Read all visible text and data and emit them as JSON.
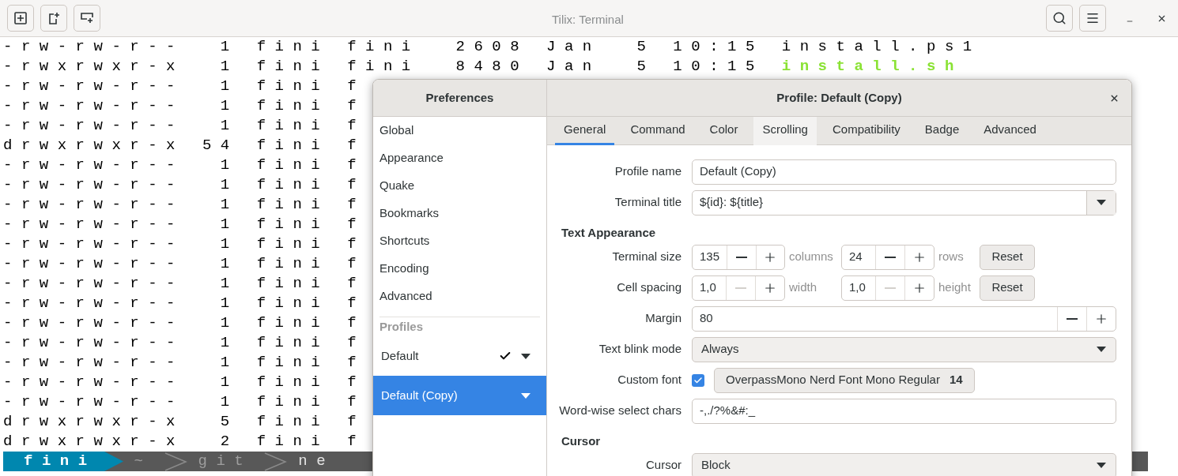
{
  "window": {
    "title": "Tilix: Terminal"
  },
  "terminal": {
    "lines": [
      {
        "text": "-rw-rw-r--  1 fini fini  2608 Jan  5 10:15 ",
        "file": "install.ps1",
        "executable": false
      },
      {
        "text": "-rwxrwxr-x  1 fini fini  8480 Jan  5 10:15 ",
        "file": "install.sh",
        "executable": true
      },
      {
        "text": "-rw-rw-r--  1 fini f"
      },
      {
        "text": "-rw-rw-r--  1 fini f"
      },
      {
        "text": "-rw-rw-r--  1 fini f"
      },
      {
        "text": "drwxrwxr-x 54 fini f"
      },
      {
        "text": "-rw-rw-r--  1 fini f"
      },
      {
        "text": "-rw-rw-r--  1 fini f"
      },
      {
        "text": "-rw-rw-r--  1 fini f"
      },
      {
        "text": "-rw-rw-r--  1 fini f"
      },
      {
        "text": "-rw-rw-r--  1 fini f"
      },
      {
        "text": "-rw-rw-r--  1 fini f"
      },
      {
        "text": "-rw-rw-r--  1 fini f"
      },
      {
        "text": "-rw-rw-r--  1 fini f"
      },
      {
        "text": "-rw-rw-r--  1 fini f"
      },
      {
        "text": "-rw-rw-r--  1 fini f"
      },
      {
        "text": "-rw-rw-r--  1 fini f"
      },
      {
        "text": "-rw-rw-r--  1 fini f"
      },
      {
        "text": "-rw-rw-r--  1 fini f"
      },
      {
        "text": "drwxrwxr-x  5 fini f"
      },
      {
        "text": "drwxrwxr-x  2 fini f"
      }
    ],
    "prompt": {
      "user": "fini",
      "segments": [
        "~",
        "git",
        "ne"
      ]
    }
  },
  "preferences": {
    "title": "Preferences",
    "items": [
      {
        "label": "Global",
        "selected": false
      },
      {
        "label": "Appearance",
        "selected": false
      },
      {
        "label": "Quake",
        "selected": false
      },
      {
        "label": "Bookmarks",
        "selected": false
      },
      {
        "label": "Shortcuts",
        "selected": false
      },
      {
        "label": "Encoding",
        "selected": false
      },
      {
        "label": "Advanced",
        "selected": false
      }
    ],
    "profiles_heading": "Profiles",
    "profiles": [
      {
        "label": "Default",
        "default": true,
        "selected": false
      },
      {
        "label": "Default (Copy)",
        "default": false,
        "selected": true
      }
    ]
  },
  "profile": {
    "title": "Profile: Default (Copy)",
    "tabs": [
      {
        "label": "General",
        "selected": true,
        "hovered": false
      },
      {
        "label": "Command",
        "selected": false,
        "hovered": false
      },
      {
        "label": "Color",
        "selected": false,
        "hovered": false
      },
      {
        "label": "Scrolling",
        "selected": false,
        "hovered": true
      },
      {
        "label": "Compatibility",
        "selected": false,
        "hovered": false
      },
      {
        "label": "Badge",
        "selected": false,
        "hovered": false
      },
      {
        "label": "Advanced",
        "selected": false,
        "hovered": false
      }
    ],
    "form": [
      {
        "kind": "entry",
        "label": "Profile name",
        "value": "Default (Copy)"
      },
      {
        "kind": "combo",
        "label": "Terminal title",
        "value": "${id}: ${title}"
      },
      {
        "kind": "heading",
        "label": "Text Appearance"
      },
      {
        "kind": "spin-pair",
        "label": "Terminal size",
        "first": {
          "value": "135",
          "unit": "columns",
          "minus_disabled": false
        },
        "second": {
          "value": "24",
          "unit": "rows",
          "minus_disabled": false
        },
        "button": "Reset"
      },
      {
        "kind": "spin-pair",
        "label": "Cell spacing",
        "first": {
          "value": "1,0",
          "unit": "width",
          "minus_disabled": true
        },
        "second": {
          "value": "1,0",
          "unit": "height",
          "minus_disabled": true
        },
        "button": "Reset"
      },
      {
        "kind": "spin",
        "label": "Margin",
        "value": "80"
      },
      {
        "kind": "dropdown",
        "label": "Text blink mode",
        "value": "Always"
      },
      {
        "kind": "font",
        "label": "Custom font",
        "checked": true,
        "font": "OverpassMono Nerd Font Mono Regular",
        "size": "14"
      },
      {
        "kind": "entry",
        "label": "Word-wise select chars",
        "value": "-,./?%&#:_"
      },
      {
        "kind": "heading",
        "label": "Cursor"
      },
      {
        "kind": "dropdown",
        "label": "Cursor",
        "value": "Block"
      }
    ]
  }
}
